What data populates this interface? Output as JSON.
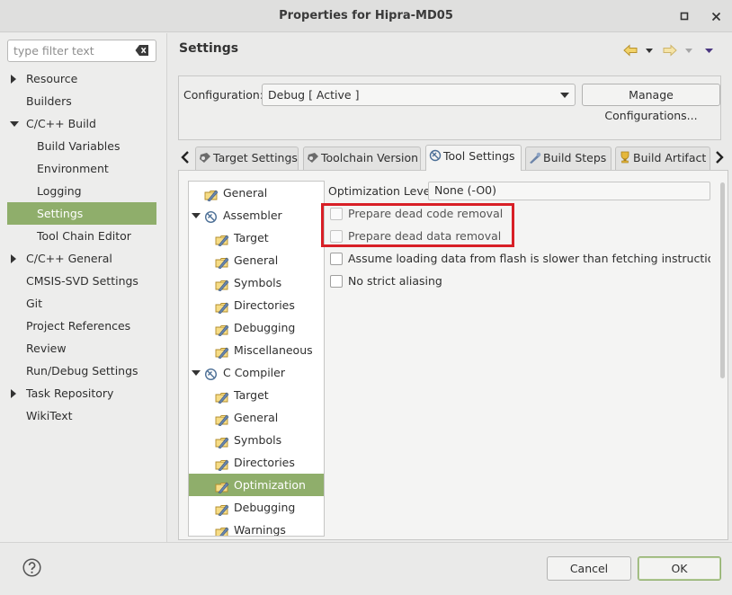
{
  "window": {
    "title": "Properties for Hipra-MD05",
    "minimize_glyph": "▫",
    "close_glyph": "✕"
  },
  "filter": {
    "placeholder": "type filter text"
  },
  "nav": {
    "items": [
      {
        "label": "Resource",
        "indent": 0,
        "expander": "right",
        "selected": false
      },
      {
        "label": "Builders",
        "indent": 0,
        "expander": "",
        "selected": false
      },
      {
        "label": "C/C++ Build",
        "indent": 0,
        "expander": "down",
        "selected": false
      },
      {
        "label": "Build Variables",
        "indent": 1,
        "expander": "",
        "selected": false
      },
      {
        "label": "Environment",
        "indent": 1,
        "expander": "",
        "selected": false
      },
      {
        "label": "Logging",
        "indent": 1,
        "expander": "",
        "selected": false
      },
      {
        "label": "Settings",
        "indent": 1,
        "expander": "",
        "selected": true
      },
      {
        "label": "Tool Chain Editor",
        "indent": 1,
        "expander": "",
        "selected": false
      },
      {
        "label": "C/C++ General",
        "indent": 0,
        "expander": "right",
        "selected": false
      },
      {
        "label": "CMSIS-SVD Settings",
        "indent": 0,
        "expander": "",
        "selected": false
      },
      {
        "label": "Git",
        "indent": 0,
        "expander": "",
        "selected": false
      },
      {
        "label": "Project References",
        "indent": 0,
        "expander": "",
        "selected": false
      },
      {
        "label": "Review",
        "indent": 0,
        "expander": "",
        "selected": false
      },
      {
        "label": "Run/Debug Settings",
        "indent": 0,
        "expander": "",
        "selected": false
      },
      {
        "label": "Task Repository",
        "indent": 0,
        "expander": "right",
        "selected": false
      },
      {
        "label": "WikiText",
        "indent": 0,
        "expander": "",
        "selected": false
      }
    ]
  },
  "header": {
    "title": "Settings"
  },
  "config": {
    "label": "Configuration:",
    "value": "Debug  [ Active ]",
    "manage_label": "Manage Configurations..."
  },
  "tabs": [
    {
      "label": "Target Settings",
      "active": false
    },
    {
      "label": "Toolchain Version",
      "active": false
    },
    {
      "label": "Tool Settings",
      "active": true
    },
    {
      "label": "Build Steps",
      "active": false
    },
    {
      "label": "Build Artifact",
      "active": false
    }
  ],
  "tree": {
    "items": [
      {
        "label": "General",
        "level": 1,
        "kind": "option",
        "expanded": false,
        "selected": false
      },
      {
        "label": "Assembler",
        "level": 0,
        "kind": "tool",
        "expanded": true,
        "selected": false
      },
      {
        "label": "Target",
        "level": 1,
        "kind": "option",
        "expanded": false,
        "selected": false
      },
      {
        "label": "General",
        "level": 1,
        "kind": "option",
        "expanded": false,
        "selected": false
      },
      {
        "label": "Symbols",
        "level": 1,
        "kind": "option",
        "expanded": false,
        "selected": false
      },
      {
        "label": "Directories",
        "level": 1,
        "kind": "option",
        "expanded": false,
        "selected": false
      },
      {
        "label": "Debugging",
        "level": 1,
        "kind": "option",
        "expanded": false,
        "selected": false
      },
      {
        "label": "Miscellaneous",
        "level": 1,
        "kind": "option",
        "expanded": false,
        "selected": false
      },
      {
        "label": "C Compiler",
        "level": 0,
        "kind": "tool",
        "expanded": true,
        "selected": false
      },
      {
        "label": "Target",
        "level": 1,
        "kind": "option",
        "expanded": false,
        "selected": false
      },
      {
        "label": "General",
        "level": 1,
        "kind": "option",
        "expanded": false,
        "selected": false
      },
      {
        "label": "Symbols",
        "level": 1,
        "kind": "option",
        "expanded": false,
        "selected": false
      },
      {
        "label": "Directories",
        "level": 1,
        "kind": "option",
        "expanded": false,
        "selected": false
      },
      {
        "label": "Optimization",
        "level": 1,
        "kind": "option",
        "expanded": false,
        "selected": true
      },
      {
        "label": "Debugging",
        "level": 1,
        "kind": "option",
        "expanded": false,
        "selected": false
      },
      {
        "label": "Warnings",
        "level": 1,
        "kind": "option",
        "expanded": false,
        "selected": false
      }
    ]
  },
  "options": {
    "level_label": "Optimization Level",
    "level_value": "None (-O0)",
    "checkboxes": [
      {
        "label": "Prepare dead code removal",
        "checked": false,
        "dim": true
      },
      {
        "label": "Prepare dead data removal",
        "checked": false,
        "dim": true
      },
      {
        "label": "Assume loading data from flash is slower than fetching instruction (-mslc",
        "checked": false,
        "dim": false
      },
      {
        "label": "No strict aliasing",
        "checked": false,
        "dim": false
      }
    ]
  },
  "buttons": {
    "cancel": "Cancel",
    "ok": "OK"
  },
  "colors": {
    "selection": "#8fae6b",
    "highlight_box": "#d81f26",
    "back_arrow": "#e8c24a",
    "forward_arrow": "#edd890",
    "menu_arrow": "#5a3f8a"
  }
}
